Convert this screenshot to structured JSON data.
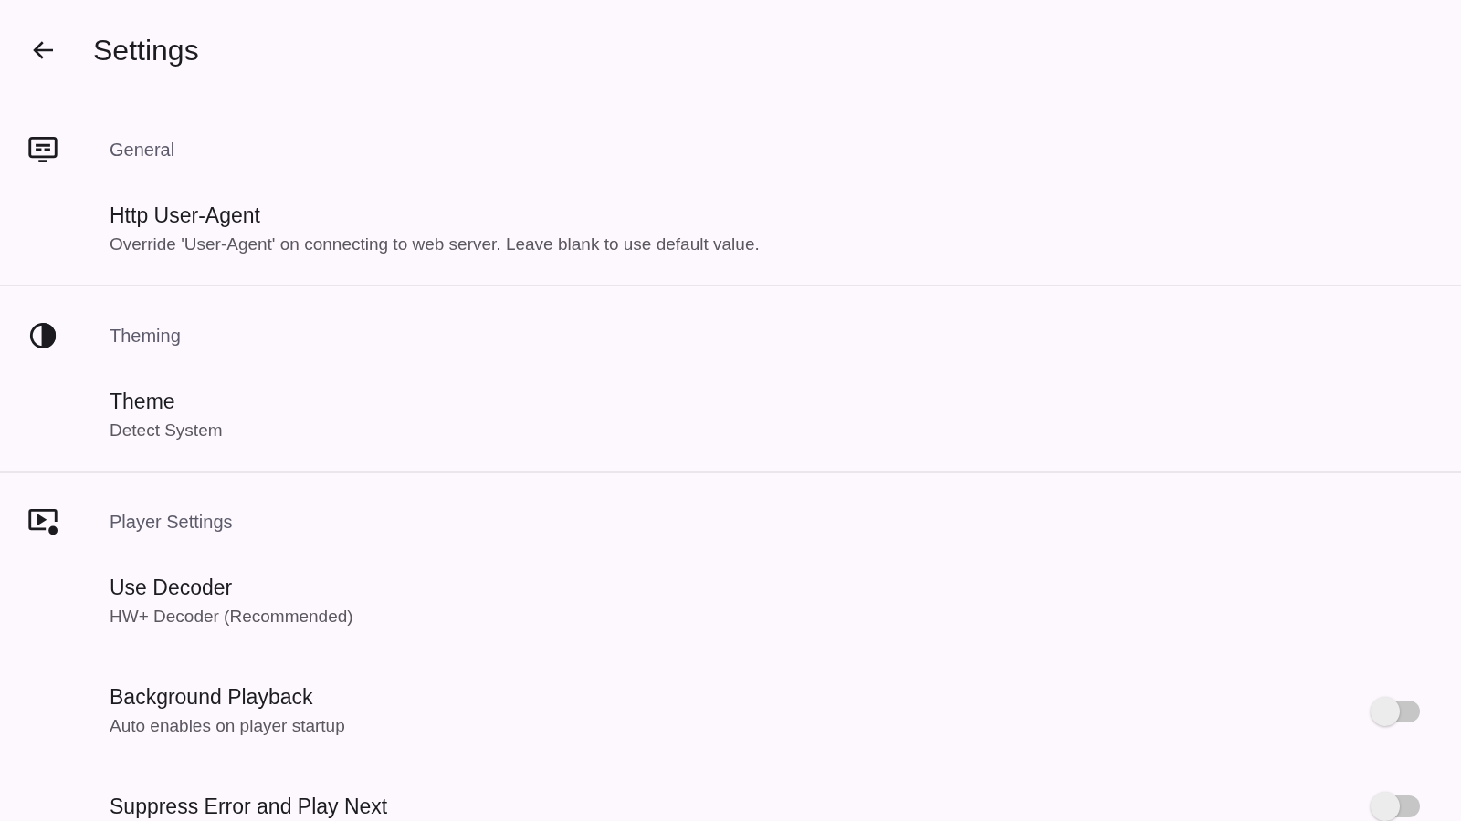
{
  "header": {
    "title": "Settings"
  },
  "sections": [
    {
      "kind": "general",
      "title": "General",
      "items": [
        {
          "kind": "value",
          "title": "Http User-Agent",
          "subtitle": "Override 'User-Agent' on connecting to web server. Leave blank to use default value."
        }
      ]
    },
    {
      "kind": "theming",
      "title": "Theming",
      "items": [
        {
          "kind": "value",
          "title": "Theme",
          "subtitle": "Detect System"
        }
      ]
    },
    {
      "kind": "player",
      "title": "Player Settings",
      "items": [
        {
          "kind": "value",
          "title": "Use Decoder",
          "subtitle": "HW+ Decoder (Recommended)"
        },
        {
          "kind": "toggle",
          "title": "Background Playback",
          "subtitle": "Auto enables on player startup",
          "on": false
        },
        {
          "kind": "toggle",
          "title": "Suppress Error and Play Next",
          "on": false
        }
      ]
    }
  ]
}
